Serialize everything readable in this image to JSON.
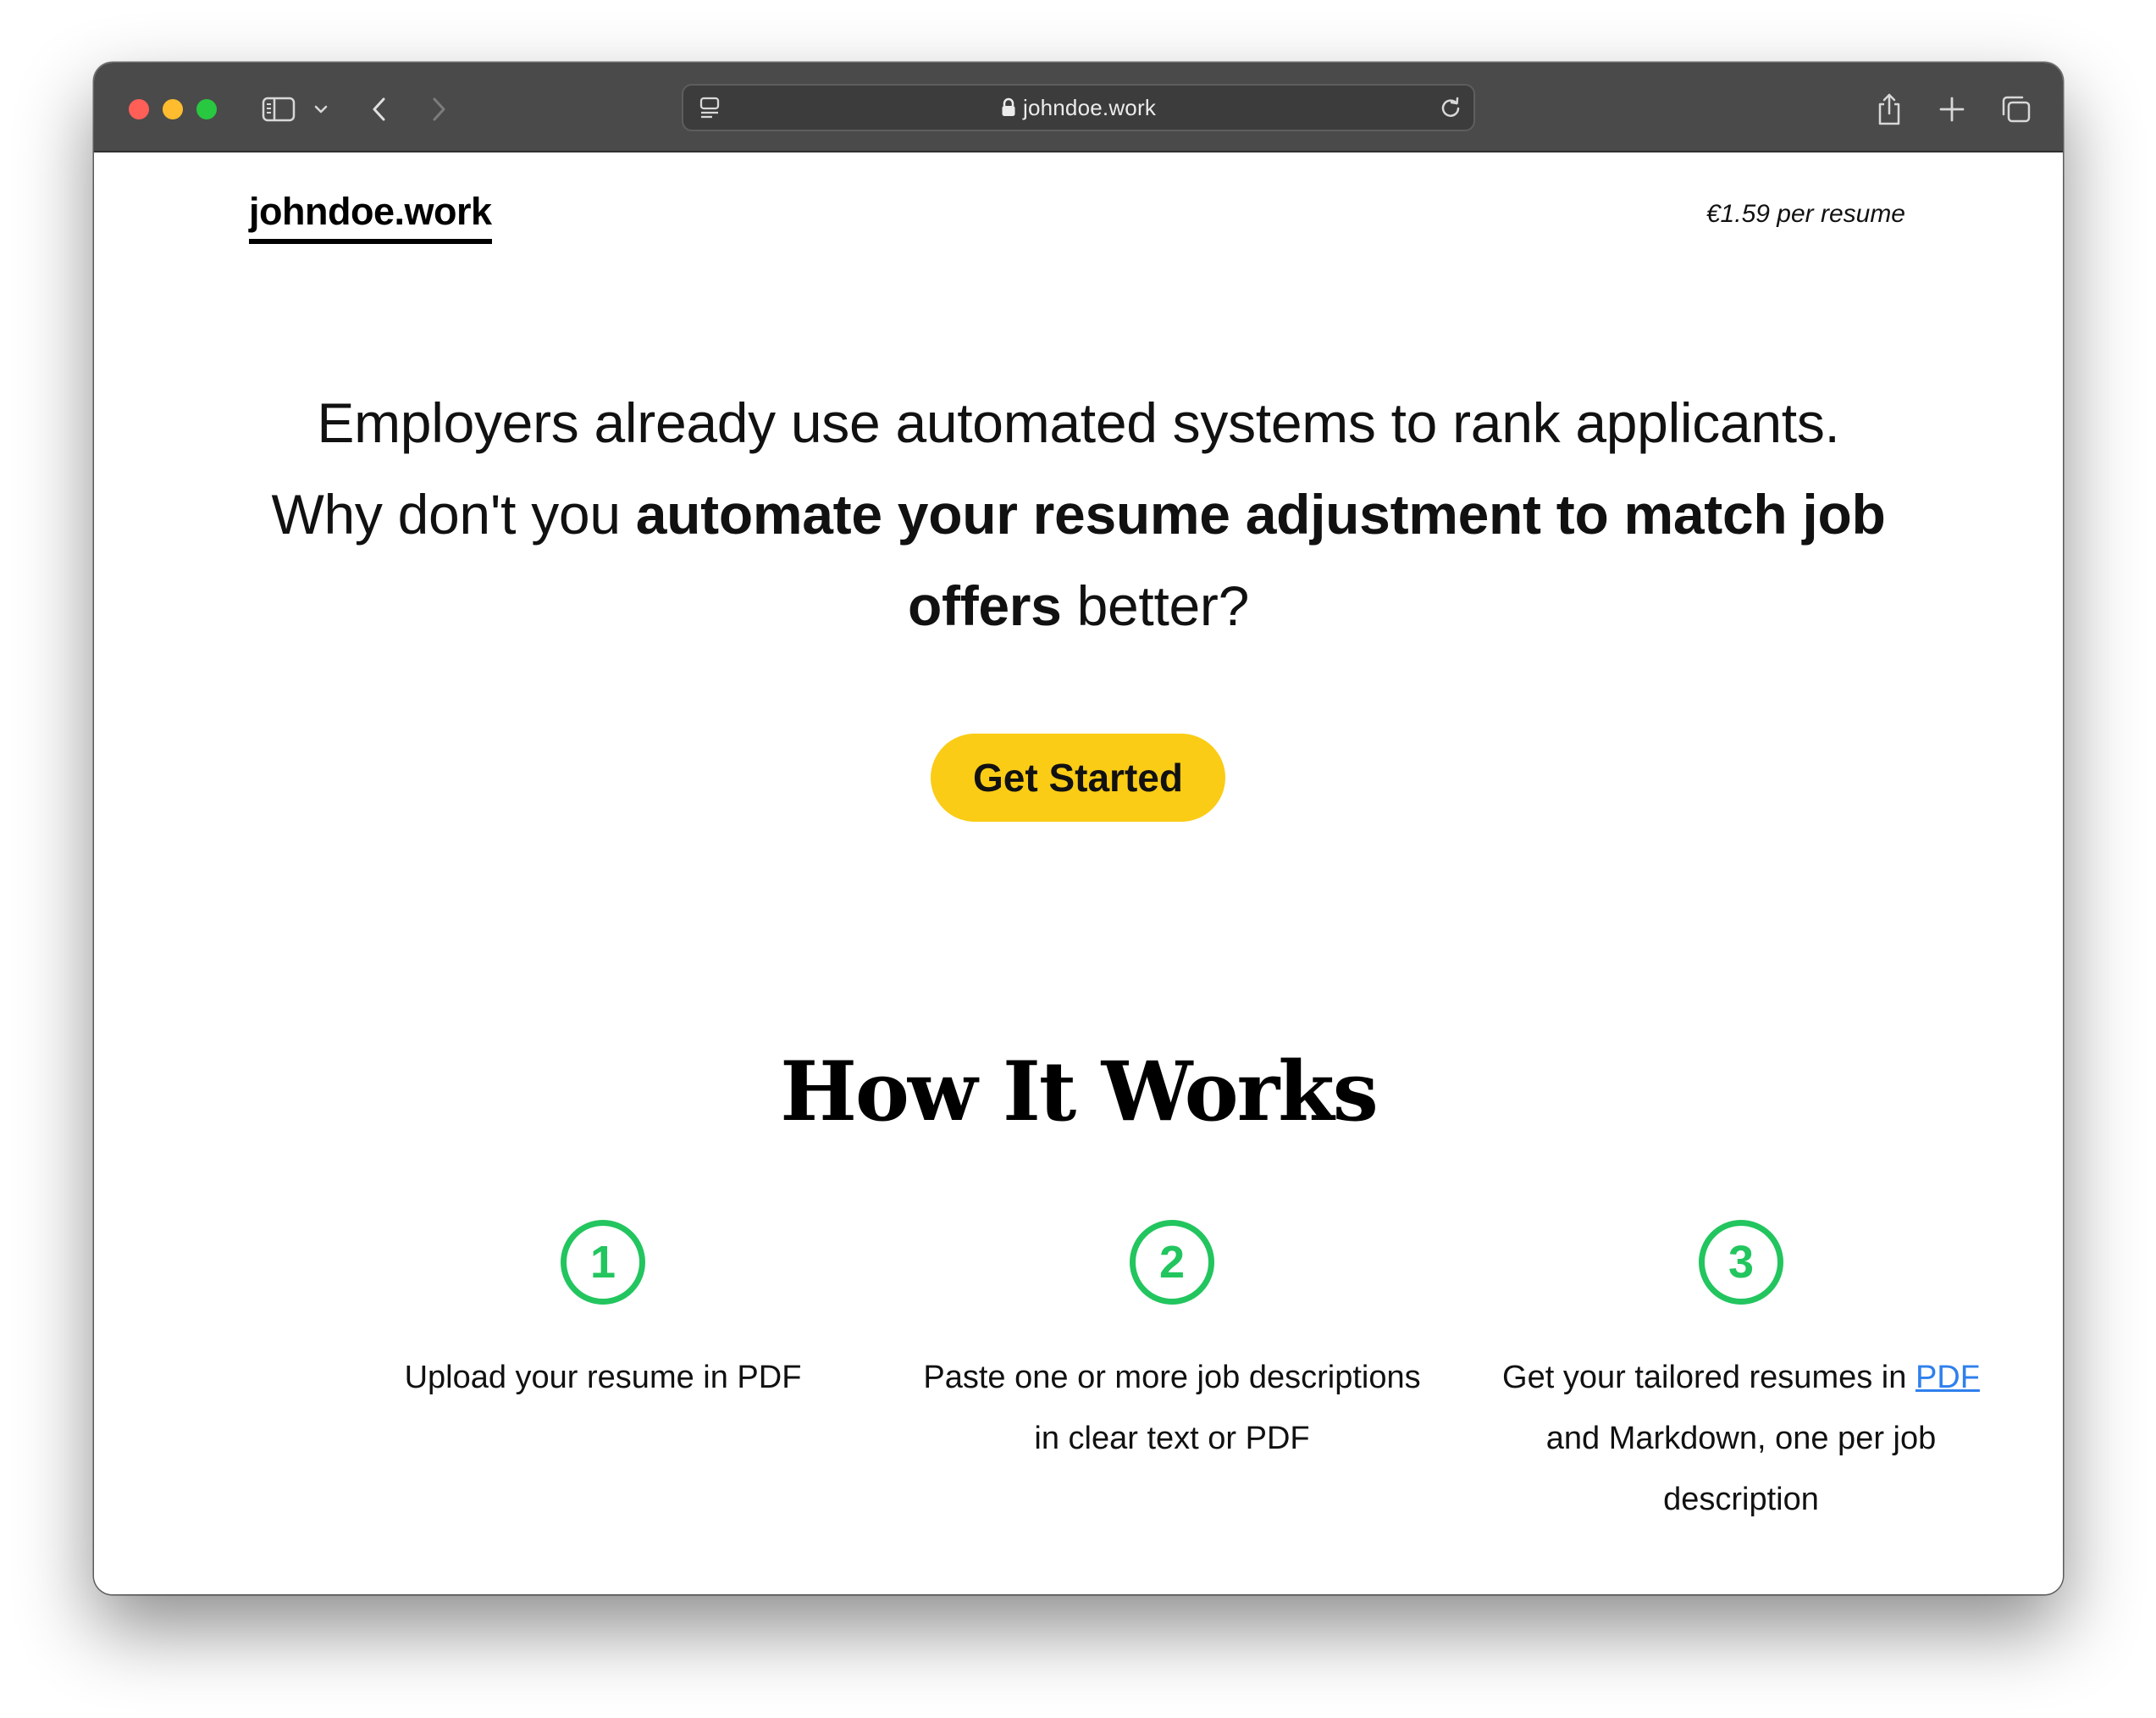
{
  "browser": {
    "url": "johndoe.work"
  },
  "header": {
    "logo": "johndoe.work",
    "price": "€1.59 per resume"
  },
  "hero": {
    "line1": "Employers already use automated systems to rank applicants.",
    "line2_prefix": "Why don't you ",
    "line2_bold": "automate your resume adjustment to match job offers",
    "line2_suffix": " better?",
    "cta_label": "Get Started"
  },
  "how_it_works": {
    "title": "How It Works",
    "steps": [
      {
        "number": "1",
        "text": "Upload your resume in PDF"
      },
      {
        "number": "2",
        "text": "Paste one or more job descriptions in clear text or PDF"
      },
      {
        "number": "3",
        "text_prefix": "Get your tailored resumes in ",
        "link": "PDF",
        "text_suffix": " and Markdown, one per job description"
      }
    ]
  },
  "colors": {
    "accent_yellow": "#facc15",
    "step_green": "#22c55e",
    "link_blue": "#2f80ed",
    "titlebar": "#4a4a4a"
  },
  "icons": [
    "sidebar-icon",
    "chevron-down-icon",
    "back-arrow-icon",
    "forward-arrow-icon",
    "reader-icon",
    "lock-icon",
    "reload-icon",
    "share-icon",
    "new-tab-plus-icon",
    "tabs-overview-icon"
  ]
}
